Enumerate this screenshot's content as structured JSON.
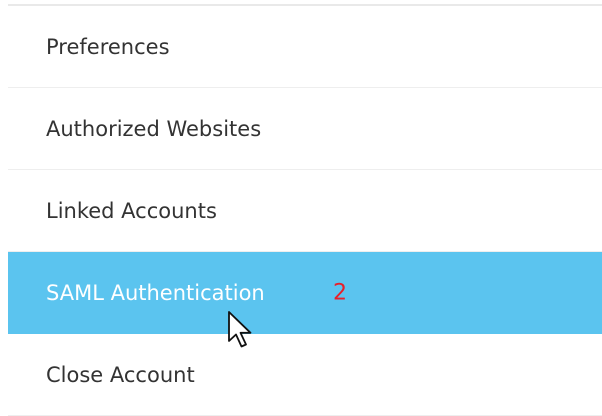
{
  "menu": {
    "items": [
      {
        "label": "Preferences"
      },
      {
        "label": "Authorized Websites"
      },
      {
        "label": "Linked Accounts"
      },
      {
        "label": "SAML Authentication",
        "active": true
      },
      {
        "label": "Close Account"
      }
    ]
  },
  "annotation": {
    "step": "2",
    "color": "#e8202a"
  },
  "colors": {
    "active_background": "#5bc4ef",
    "active_text": "#ffffff",
    "text": "#333333"
  },
  "icons": {
    "cursor": "mouse-pointer-icon"
  }
}
